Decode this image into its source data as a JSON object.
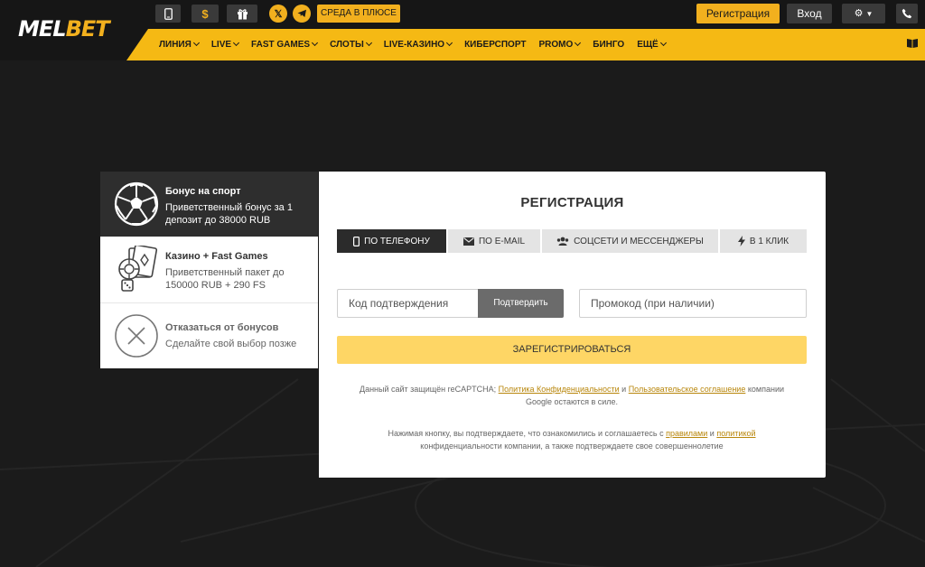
{
  "header": {
    "logo_part1": "MEL",
    "logo_part2": "BET",
    "promo_badge": "СРЕДА В ПЛЮСЕ",
    "register_label": "Регистрация",
    "login_label": "Вход",
    "icons": [
      "mobile-icon",
      "dollar-icon",
      "gift-icon",
      "x-icon",
      "telegram-icon",
      "gear-icon",
      "phone-icon",
      "book-icon"
    ],
    "accent_color": "#f5b914"
  },
  "nav": {
    "items": [
      {
        "label": "ЛИНИЯ",
        "dropdown": true
      },
      {
        "label": "LIVE",
        "dropdown": true
      },
      {
        "label": "FAST GAMES",
        "dropdown": true
      },
      {
        "label": "СЛОТЫ",
        "dropdown": true
      },
      {
        "label": "LIVE-КАЗИНО",
        "dropdown": true
      },
      {
        "label": "КИБЕРСПОРТ",
        "dropdown": false
      },
      {
        "label": "PROMO",
        "dropdown": true
      },
      {
        "label": "БИНГО",
        "dropdown": false
      },
      {
        "label": "ЕЩЁ",
        "dropdown": true
      }
    ]
  },
  "bonuses": [
    {
      "title": "Бонус на спорт",
      "line1": "Приветственный бонус за 1",
      "line2": "депозит до 38000 RUB",
      "icon": "soccer-ball-icon",
      "active": true
    },
    {
      "title": "Казино + Fast Games",
      "line1": "Приветственный пакет до",
      "line2": "150000 RUB + 290 FS",
      "icon": "cards-dice-icon",
      "active": false
    },
    {
      "title": "Отказаться от бонусов",
      "line1": "Сделайте свой выбор позже",
      "line2": "",
      "icon": "close-circle-icon",
      "active": false
    }
  ],
  "registration": {
    "title": "РЕГИСТРАЦИЯ",
    "tabs": [
      {
        "label": "ПО ТЕЛЕФОНУ",
        "icon": "phone-icon",
        "active": true
      },
      {
        "label": "ПО E-MAIL",
        "icon": "envelope-icon",
        "active": false
      },
      {
        "label": "СОЦСЕТИ И МЕССЕНДЖЕРЫ",
        "icon": "users-icon",
        "active": false
      },
      {
        "label": "В 1 КЛИК",
        "icon": "lightning-icon",
        "active": false
      }
    ],
    "code_placeholder": "Код подтверждения",
    "confirm_label": "Подтвердить",
    "promo_placeholder": "Промокод (при наличии)",
    "submit_label": "ЗАРЕГИСТРИРОВАТЬСЯ",
    "recaptcha_text1": "Данный сайт защищён reCAPTCHA;",
    "recaptcha_link1": "Политика Конфиденциальности",
    "recaptcha_and": "и",
    "recaptcha_link2": "Пользовательское соглашение",
    "recaptcha_text2": "компании",
    "recaptcha_text3": "Google остаются в силе.",
    "terms_text1": "Нажимая кнопку, вы подтверждаете, что ознакомились и соглашаетесь с",
    "terms_link1": "правилами",
    "terms_and": "и",
    "terms_link2": "политикой",
    "terms_text2": "конфиденциальности компании, а также подтверждаете свое совершеннолетие"
  }
}
